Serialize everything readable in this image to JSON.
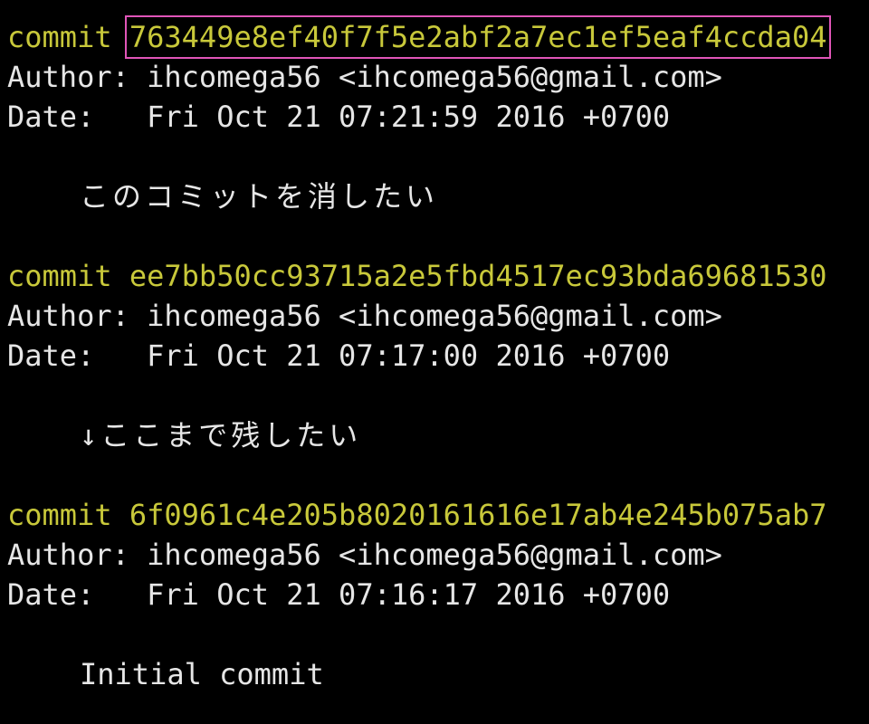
{
  "colors": {
    "background": "#000000",
    "text": "#e6e6e6",
    "commit_yellow": "#c8c83a",
    "highlight_border": "#e055b8"
  },
  "labels": {
    "commit": "commit",
    "author": "Author: ",
    "date": "Date:   "
  },
  "commits": [
    {
      "hash": "763449e8ef40f7f5e2abf2a7ec1ef5eaf4ccda04",
      "author": "ihcomega56 <ihcomega56@gmail.com>",
      "date": "Fri Oct 21 07:21:59 2016 +0700",
      "message": "このコミットを消したい",
      "highlighted": true
    },
    {
      "hash": "ee7bb50cc93715a2e5fbd4517ec93bda69681530",
      "author": "ihcomega56 <ihcomega56@gmail.com>",
      "date": "Fri Oct 21 07:17:00 2016 +0700",
      "message": "↓ここまで残したい",
      "highlighted": false
    },
    {
      "hash": "6f0961c4e205b8020161616e17ab4e245b075ab7",
      "author": "ihcomega56 <ihcomega56@gmail.com>",
      "date": "Fri Oct 21 07:16:17 2016 +0700",
      "message": "Initial commit",
      "highlighted": false
    }
  ]
}
